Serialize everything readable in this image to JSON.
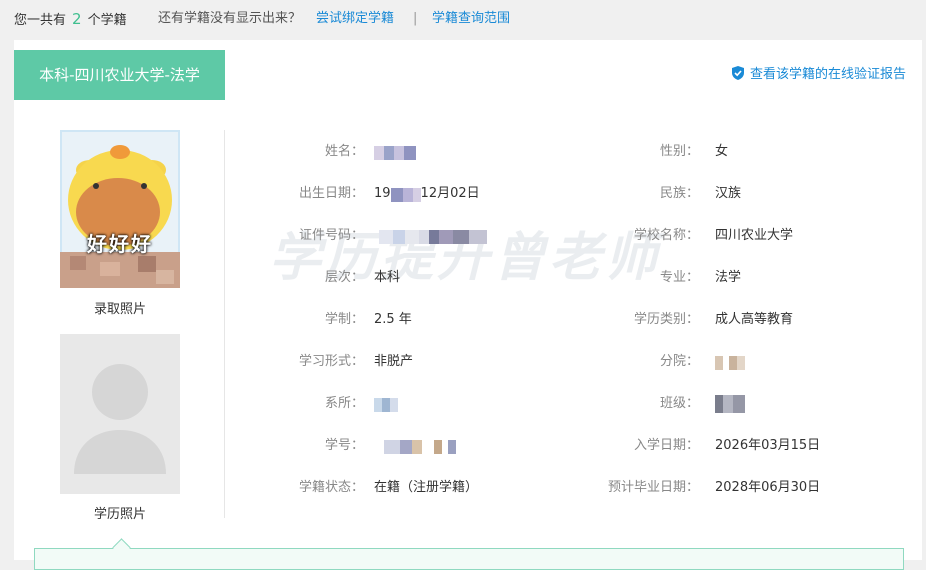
{
  "top": {
    "prefix": "您一共有",
    "count": "2",
    "suffix": "个学籍",
    "question": "还有学籍没有显示出来？",
    "bind_link": "尝试绑定学籍",
    "separator": "|",
    "scope_link": "学籍查询范围"
  },
  "card": {
    "title": "本科-四川农业大学-法学",
    "verify_link": "查看该学籍的在线验证报告",
    "admission_photo_label": "录取照片",
    "admission_photo_caption": "好好好",
    "degree_photo_label": "学历照片",
    "watermark": "学历提升曾老师"
  },
  "left_fields": [
    {
      "label": "姓名：",
      "value": "",
      "redacted": true
    },
    {
      "label": "出生日期：",
      "value_prefix": "19",
      "value_suffix": "12月02日",
      "partial": true
    },
    {
      "label": "证件号码：",
      "value": "",
      "redacted": true
    },
    {
      "label": "层次：",
      "value": "本科"
    },
    {
      "label": "学制：",
      "value": "2.5 年"
    },
    {
      "label": "学习形式：",
      "value": "非脱产"
    },
    {
      "label": "系所：",
      "value": "",
      "redacted": true
    },
    {
      "label": "学号：",
      "value": "",
      "redacted": true
    },
    {
      "label": "学籍状态：",
      "value": "在籍（注册学籍）"
    }
  ],
  "right_fields": [
    {
      "label": "性别：",
      "value": "女"
    },
    {
      "label": "民族：",
      "value": "汉族"
    },
    {
      "label": "学校名称：",
      "value": "四川农业大学"
    },
    {
      "label": "专业：",
      "value": "法学"
    },
    {
      "label": "学历类别：",
      "value": "成人高等教育"
    },
    {
      "label": "分院：",
      "value": "",
      "redacted": true
    },
    {
      "label": "班级：",
      "value": "",
      "redacted": true
    },
    {
      "label": "入学日期：",
      "value": "2026年03月15日"
    },
    {
      "label": "预计毕业日期：",
      "value": "2028年06月30日"
    }
  ],
  "colors": {
    "accent": "#5ec9a6",
    "link": "#1a8ad6",
    "count": "#3fbf8f"
  }
}
